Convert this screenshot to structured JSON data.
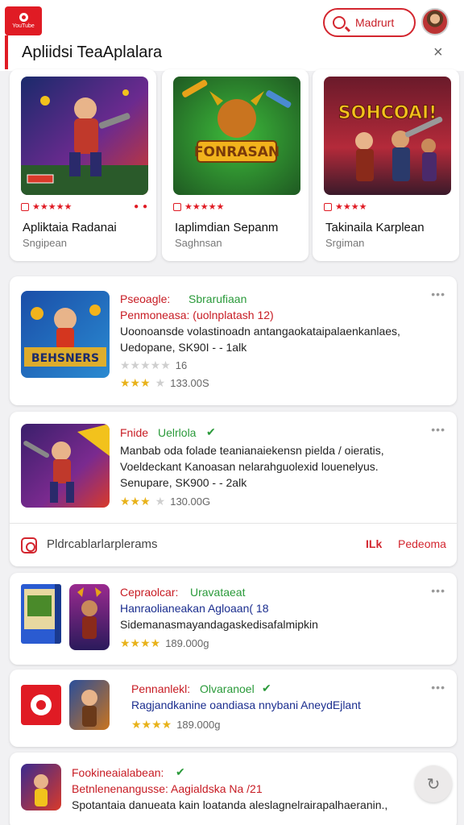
{
  "header": {
    "logo_text": "YouTube",
    "search_label": "Madrurt",
    "page_title": "Apliidsi TeaAplalara",
    "close_glyph": "×"
  },
  "featured": [
    {
      "name": "Apliktaia Radanai",
      "sub": "Sngipean",
      "stars": "★★★★★",
      "colors": [
        "#1a2a6b",
        "#6b2a8f",
        "#d23a2a"
      ]
    },
    {
      "name": "Iaplimdian Sepanm",
      "sub": "Saghnsan",
      "art_title": "FONRASAN",
      "stars": "★★★★★",
      "colors": [
        "#1f7a2a",
        "#3dbb3b",
        "#d99a12"
      ]
    },
    {
      "name": "Takinaila Karplean",
      "sub": "Srgiman",
      "art_title": "SOHCOAI!",
      "stars": "★★★★",
      "colors": [
        "#6a1a2a",
        "#b42a3a",
        "#e09a2a"
      ]
    }
  ],
  "list": [
    {
      "cat": "Pseoagle:",
      "tag": "Sbrarufiaan",
      "title": "Penmoneasa: (uolnplatash 12)",
      "desc": "Uoonoansde volastinoadn antangaokataipalaenkanlaes,",
      "meta": "Uedopane, SK90I - - 1alk",
      "rating1": "16",
      "rating2": "133.00S",
      "art_title": "BEHSNERS",
      "colors": [
        "#1a4ea8",
        "#f2b31c",
        "#d4361f"
      ]
    },
    {
      "cat": "Fnide",
      "tag": "Uelrlola",
      "title": "Manbab oda  folade teanianaiekensn pielda / oieratis,",
      "desc": "Voeldeckant Kanoasan nelarahguolexid louenelyus.",
      "meta": "Senupare, SK900 - - 2alk",
      "rating2": "130.00G",
      "colors": [
        "#3a1f6b",
        "#d93a2a",
        "#f2c21c"
      ]
    },
    {
      "cat": "Cepraolcar:",
      "tag": "Uravataeat",
      "title": "Hanraolianeakan Agloaan( 18",
      "desc": "Sidemanasmayandagaskedisafalmipkin",
      "rating2": "189.000g",
      "colors": [
        "#2a5bd1",
        "#9a2a8f",
        "#e8a21a"
      ]
    },
    {
      "cat": "Pennanlekl:",
      "tag": "Olvaranoel",
      "title": "Ragjandkanine oandiasa nnybani AneydEjlant",
      "rating2": "189.000g",
      "colors": [
        "#6b3a1a",
        "#c9741f",
        "#2a4e9a"
      ]
    },
    {
      "cat": "Fookineaialabean:",
      "tag": "",
      "title": "Betnlenenangusse: Aagialdska Na /21",
      "desc": "Spotantaia danueata kain loatanda aleslagnelrairapalhaeranin.,",
      "colors": [
        "#3a2a8f",
        "#d93a2a",
        "#f2c21c"
      ]
    }
  ],
  "action_row": {
    "label": "Pldrcablarlarplerams",
    "short": "ILk",
    "link": "Pedeoma"
  },
  "more_glyph": "•••",
  "refresh_glyph": "↻"
}
